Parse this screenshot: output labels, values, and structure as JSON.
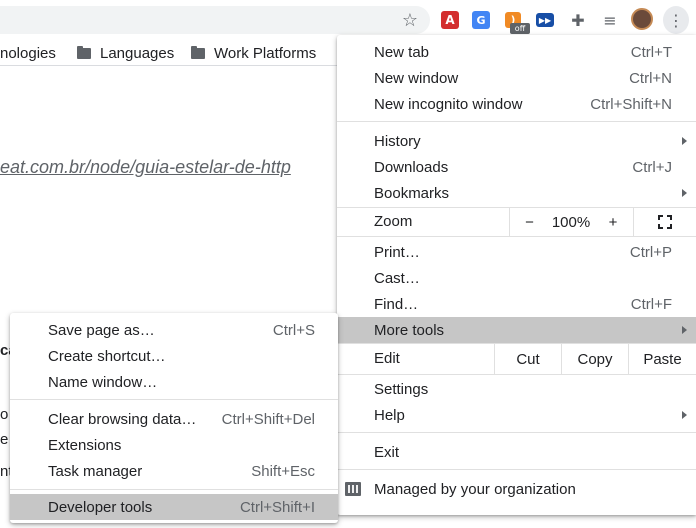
{
  "toolbar": {
    "icons": [
      "star-icon",
      "acrobat-icon",
      "translate-icon",
      "rss-icon",
      "media-icon",
      "puzzle-icon",
      "queue-icon",
      "avatar",
      "kebab-menu-icon"
    ],
    "rss_badge": "off",
    "colors": {
      "accent_red": "#d32f2f",
      "accent_blue": "#4285f4",
      "accent_orange": "#f08a24"
    }
  },
  "bookmarks": [
    {
      "label": "nologies"
    },
    {
      "label": "Languages"
    },
    {
      "label": "Work Platforms"
    }
  ],
  "page": {
    "link_text": "eat.com.br/node/guia-estelar-de-http",
    "frag_1": "ca",
    "frag_2": "o",
    "frag_3": "e",
    "frag_4": "nt"
  },
  "main_menu": {
    "new_tab": {
      "label": "New tab",
      "accel": "Ctrl+T"
    },
    "new_window": {
      "label": "New window",
      "accel": "Ctrl+N"
    },
    "new_incognito": {
      "label": "New incognito window",
      "accel": "Ctrl+Shift+N"
    },
    "history": {
      "label": "History"
    },
    "downloads": {
      "label": "Downloads",
      "accel": "Ctrl+J"
    },
    "bookmarks": {
      "label": "Bookmarks"
    },
    "zoom": {
      "label": "Zoom",
      "minus": "−",
      "value": "100%",
      "plus": "+"
    },
    "print": {
      "label": "Print…",
      "accel": "Ctrl+P"
    },
    "cast": {
      "label": "Cast…"
    },
    "find": {
      "label": "Find…",
      "accel": "Ctrl+F"
    },
    "more_tools": {
      "label": "More tools"
    },
    "edit": {
      "label": "Edit",
      "cut": "Cut",
      "copy": "Copy",
      "paste": "Paste"
    },
    "settings": {
      "label": "Settings"
    },
    "help": {
      "label": "Help"
    },
    "exit": {
      "label": "Exit"
    },
    "managed": {
      "label": "Managed by your organization"
    }
  },
  "sub_menu": {
    "save_page": {
      "label": "Save page as…",
      "accel": "Ctrl+S"
    },
    "create_shortcut": {
      "label": "Create shortcut…"
    },
    "name_window": {
      "label": "Name window…"
    },
    "clear_data": {
      "label": "Clear browsing data…",
      "accel": "Ctrl+Shift+Del"
    },
    "extensions": {
      "label": "Extensions"
    },
    "task_manager": {
      "label": "Task manager",
      "accel": "Shift+Esc"
    },
    "dev_tools": {
      "label": "Developer tools",
      "accel": "Ctrl+Shift+I"
    }
  }
}
